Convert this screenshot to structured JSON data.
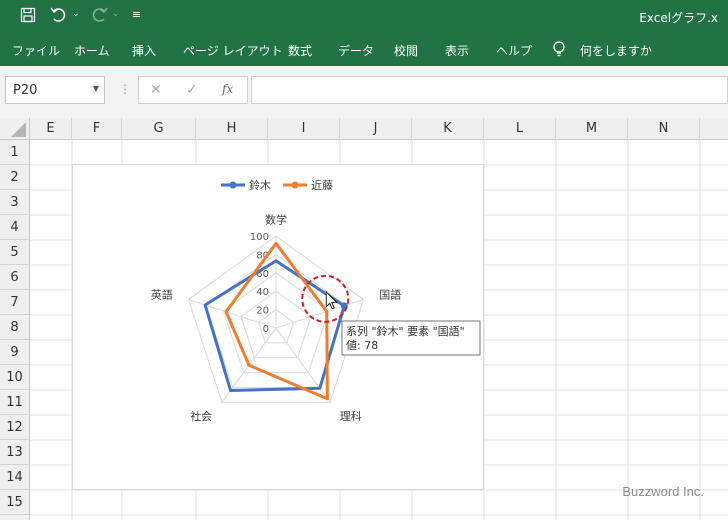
{
  "document": {
    "title": "Excelグラフ.x"
  },
  "menu": [
    "ファイル",
    "ホーム",
    "挿入",
    "ページ レイアウト",
    "数式",
    "データ",
    "校閲",
    "表示",
    "ヘルプ"
  ],
  "tell_me": {
    "icon": "lightbulb-icon",
    "label": "何をしますか"
  },
  "name_box": {
    "value": "P20"
  },
  "columns": [
    "E",
    "F",
    "G",
    "H",
    "I",
    "J",
    "K",
    "L",
    "M",
    "N"
  ],
  "rows": [
    "1",
    "2",
    "3",
    "4",
    "5",
    "6",
    "7",
    "8",
    "9",
    "10",
    "11",
    "12",
    "13",
    "14",
    "15"
  ],
  "chart_data": {
    "type": "radar",
    "categories": [
      "数学",
      "国語",
      "理科",
      "社会",
      "英語"
    ],
    "series": [
      {
        "name": "鈴木",
        "values": [
          73,
          78,
          81,
          84,
          81
        ],
        "color": "#4472c4"
      },
      {
        "name": "近藤",
        "values": [
          92,
          58,
          95,
          50,
          57
        ],
        "color": "#ed7d31"
      }
    ],
    "rlim": [
      0,
      100
    ],
    "ticks": [
      0,
      20,
      40,
      60,
      80,
      100
    ],
    "legend": "top",
    "tooltip": {
      "line1": "系列 \"鈴木\" 要素 \"国語\"",
      "line2": "値: 78"
    }
  },
  "watermark": "Buzzword Inc."
}
